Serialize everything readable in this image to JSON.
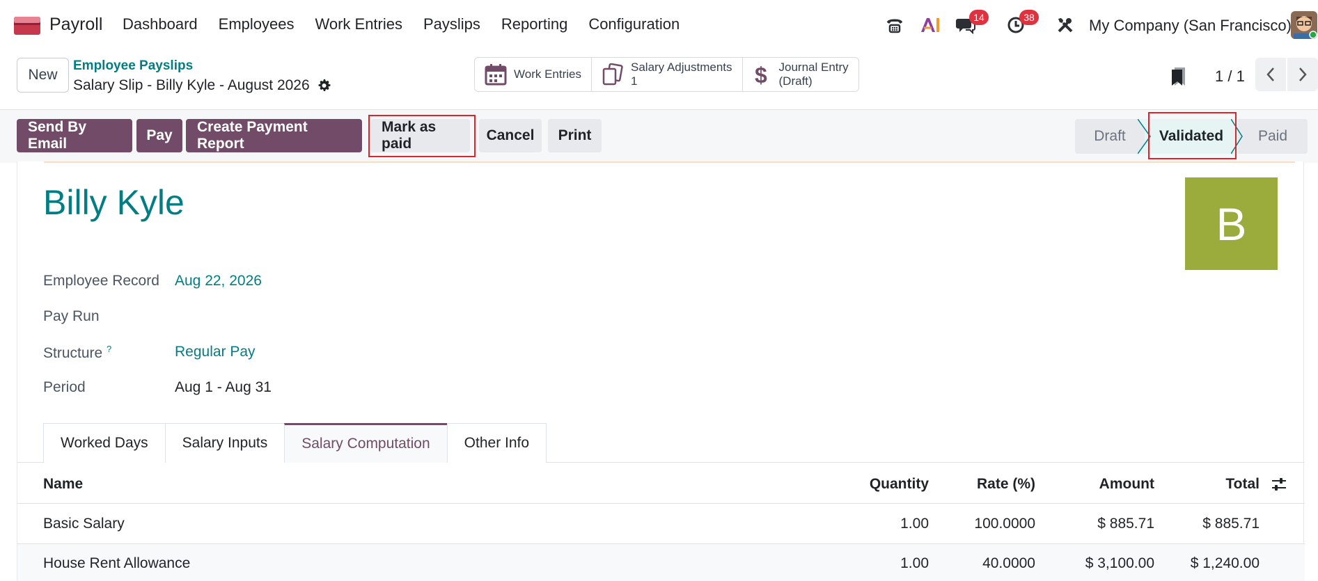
{
  "navbar": {
    "app_name": "Payroll",
    "menu": [
      "Dashboard",
      "Employees",
      "Work Entries",
      "Payslips",
      "Reporting",
      "Configuration"
    ],
    "messages_count": "14",
    "activities_count": "38",
    "company": "My Company (San Francisco)",
    "icons": [
      "phone-icon",
      "ai-icon",
      "chat-icon",
      "clock-icon",
      "tools-icon"
    ]
  },
  "control": {
    "new_label": "New",
    "breadcrumb_parent": "Employee Payslips",
    "breadcrumb_current": "Salary Slip - Billy Kyle - August 2026",
    "smart_buttons": [
      {
        "line1": "Work Entries",
        "line2": ""
      },
      {
        "line1": "Salary Adjustments",
        "line2": "1"
      },
      {
        "line1": "Journal Entry",
        "line2": "(Draft)"
      }
    ],
    "pager": "1 / 1"
  },
  "actions": {
    "send_email": "Send By Email",
    "pay": "Pay",
    "create_payment_report": "Create Payment Report",
    "mark_as_paid": "Mark as paid",
    "cancel": "Cancel",
    "print": "Print",
    "stages": [
      "Draft",
      "Validated",
      "Paid"
    ],
    "active_stage": "Validated"
  },
  "sheet": {
    "employee_name": "Billy Kyle",
    "avatar_letter": "B",
    "fields": [
      {
        "label": "Employee Record",
        "value": "Aug 22, 2026"
      },
      {
        "label": "Pay Run",
        "value": ""
      },
      {
        "label": "Structure",
        "value": "Regular Pay"
      },
      {
        "label": "Period",
        "value": "Aug 1 - Aug 31"
      }
    ],
    "structure_help": "?",
    "tabs": [
      "Worked Days",
      "Salary Inputs",
      "Salary Computation",
      "Other Info"
    ],
    "active_tab": "Salary Computation",
    "table": {
      "headers": [
        "Name",
        "Quantity",
        "Rate (%)",
        "Amount",
        "Total"
      ],
      "rows": [
        [
          "Basic Salary",
          "1.00",
          "100.0000",
          "$ 885.71",
          "$ 885.71"
        ],
        [
          "House Rent Allowance",
          "1.00",
          "40.0000",
          "$ 3,100.00",
          "$ 1,240.00"
        ]
      ]
    }
  },
  "colors": {
    "brand": "#714b67",
    "link": "#017e84",
    "badge": "#e0313f",
    "avatar_bg": "#9cac3c",
    "highlight": "#e0222b"
  }
}
